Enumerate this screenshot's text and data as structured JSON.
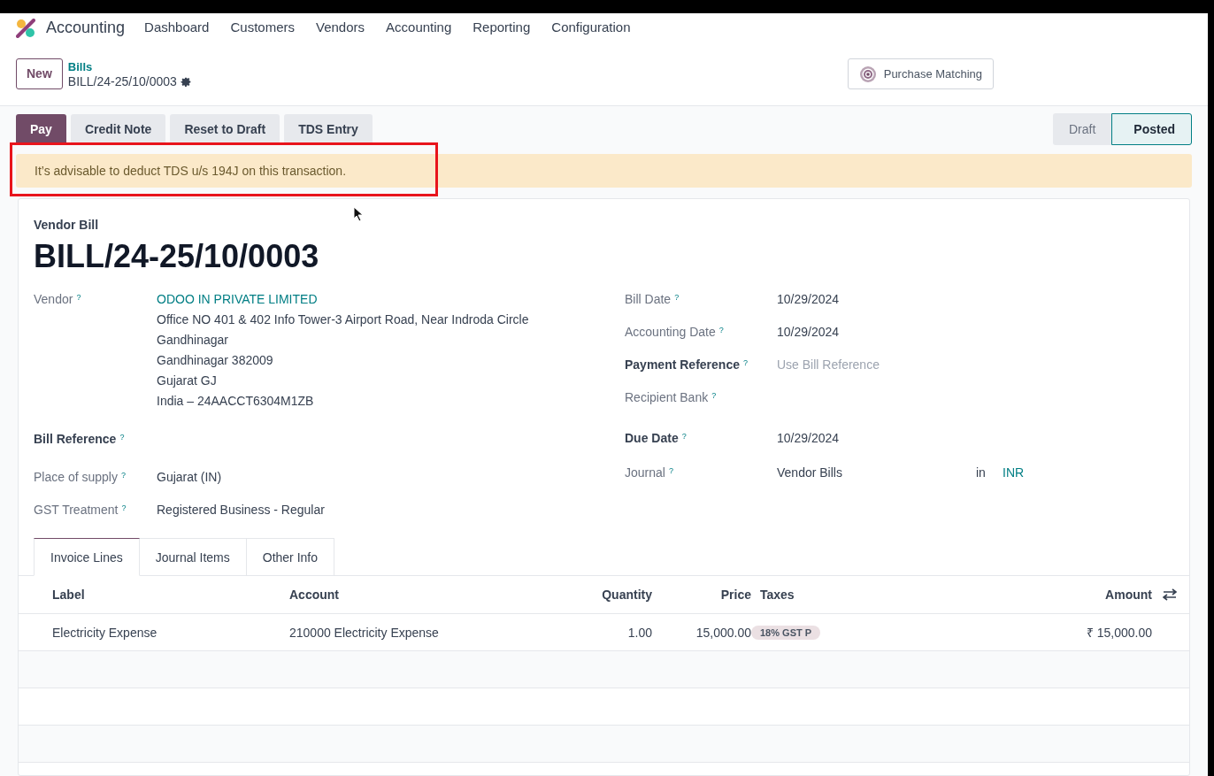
{
  "app": {
    "name": "Accounting",
    "menu": [
      "Dashboard",
      "Customers",
      "Vendors",
      "Accounting",
      "Reporting",
      "Configuration"
    ]
  },
  "control_panel": {
    "new_button": "New",
    "breadcrumb_parent": "Bills",
    "breadcrumb_current": "BILL/24-25/10/0003",
    "smart_button": "Purchase Matching"
  },
  "action_buttons": [
    {
      "label": "Pay",
      "primary": true
    },
    {
      "label": "Credit Note",
      "primary": false
    },
    {
      "label": "Reset to Draft",
      "primary": false
    },
    {
      "label": "TDS Entry",
      "primary": false
    }
  ],
  "status_steps": [
    {
      "label": "Draft",
      "selected": false
    },
    {
      "label": "Posted",
      "selected": true
    }
  ],
  "alert": {
    "text": "It’s advisable to deduct TDS u/s 194J on this transaction.",
    "highlighted": true
  },
  "sheet": {
    "type_label": "Vendor Bill",
    "title": "BILL/24-25/10/0003",
    "left_fields": [
      {
        "label": "Vendor",
        "help": "?",
        "strong": false,
        "kind": "partner",
        "value": "ODOO IN PRIVATE LIMITED",
        "address": [
          "Office NO 401 & 402 Info Tower-3 Airport Road, Near Indroda Circle",
          "Gandhinagar",
          "Gandhinagar 382009",
          "Gujarat GJ",
          "India – 24AACCT6304M1ZB"
        ]
      },
      {
        "label": "Bill Reference",
        "help": "?",
        "strong": true,
        "kind": "empty"
      },
      {
        "label": "Place of supply",
        "help": "?",
        "strong": false,
        "kind": "text",
        "value": "Gujarat (IN)"
      },
      {
        "label": "GST Treatment",
        "help": "?",
        "strong": false,
        "kind": "text",
        "value": "Registered Business - Regular"
      }
    ],
    "right_fields": [
      {
        "label": "Bill Date",
        "help": "?",
        "strong": false,
        "kind": "text",
        "value": "10/29/2024"
      },
      {
        "label": "Accounting Date",
        "help": "?",
        "strong": false,
        "kind": "text",
        "value": "10/29/2024"
      },
      {
        "label": "Payment Reference",
        "help": "?",
        "strong": true,
        "kind": "placeholder",
        "placeholder": "Use Bill Reference"
      },
      {
        "label": "Recipient Bank",
        "help": "?",
        "strong": false,
        "kind": "empty"
      },
      {
        "label": "Due Date",
        "help": "?",
        "strong": true,
        "kind": "text",
        "value": "10/29/2024"
      },
      {
        "label": "Journal",
        "help": "?",
        "strong": false,
        "kind": "journal",
        "value": "Vendor Bills",
        "connector": "in",
        "currency": "INR"
      }
    ]
  },
  "tabs": [
    {
      "label": "Invoice Lines",
      "selected": true
    },
    {
      "label": "Journal Items",
      "selected": false
    },
    {
      "label": "Other Info",
      "selected": false
    }
  ],
  "table": {
    "columns": [
      "Label",
      "Account",
      "Quantity",
      "Price",
      "Taxes",
      "Amount"
    ],
    "rows": [
      {
        "cells": [
          "Electricity Expense",
          "210000 Electricity Expense",
          "1.00",
          "15,000.00"
        ],
        "taxes": [
          "18% GST P"
        ],
        "amount": "₹ 15,000.00"
      }
    ]
  }
}
